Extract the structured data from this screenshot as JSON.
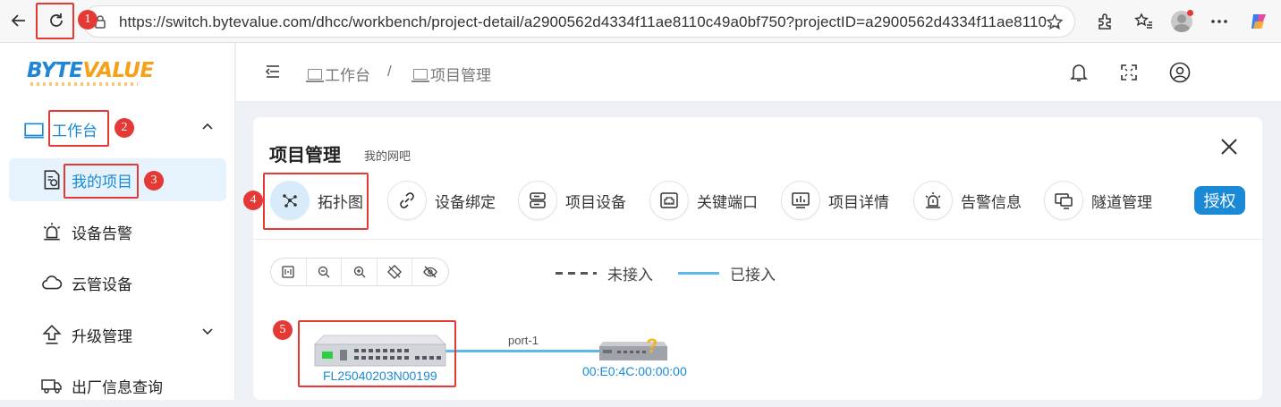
{
  "browser": {
    "url": "https://switch.bytevalue.com/dhcc/workbench/project-detail/a2900562d4334f11ae8110c49a0bf750?projectID=a2900562d4334f11ae8110..."
  },
  "badges": [
    "1",
    "2",
    "3",
    "4",
    "5"
  ],
  "logo": {
    "text_a": "BYTE",
    "text_b": "VALUE"
  },
  "sidebar": {
    "items": [
      {
        "label": "工作台",
        "icon": "monitor-icon"
      },
      {
        "label": "我的项目",
        "icon": "project-icon"
      },
      {
        "label": "设备告警",
        "icon": "alarm-icon"
      },
      {
        "label": "云管设备",
        "icon": "cloud-icon"
      },
      {
        "label": "升级管理",
        "icon": "upgrade-icon"
      },
      {
        "label": "出厂信息查询",
        "icon": "truck-icon"
      }
    ]
  },
  "breadcrumb": {
    "home": "工作台",
    "separator": "/",
    "current": "项目管理"
  },
  "card": {
    "title": "项目管理",
    "subtitle": "我的网吧"
  },
  "tabs": [
    {
      "label": "拓扑图",
      "icon": "topology-icon",
      "active": true
    },
    {
      "label": "设备绑定",
      "icon": "link-icon"
    },
    {
      "label": "项目设备",
      "icon": "server-icon"
    },
    {
      "label": "关键端口",
      "icon": "port-icon"
    },
    {
      "label": "项目详情",
      "icon": "chart-icon"
    },
    {
      "label": "告警信息",
      "icon": "alarm-icon"
    },
    {
      "label": "隧道管理",
      "icon": "tunnel-icon"
    }
  ],
  "auth_button": "授权",
  "legend": {
    "disconnected": "未接入",
    "connected": "已接入",
    "connected_color": "#5cb8ea"
  },
  "topology": {
    "switch_label": "FL25040203N00199",
    "port_label": "port-1",
    "unknown_device_label": "00:E0:4C:00:00:00",
    "unknown_mark": "?"
  },
  "colors": {
    "accent": "#1a8ad6",
    "annotation": "#e53935"
  }
}
